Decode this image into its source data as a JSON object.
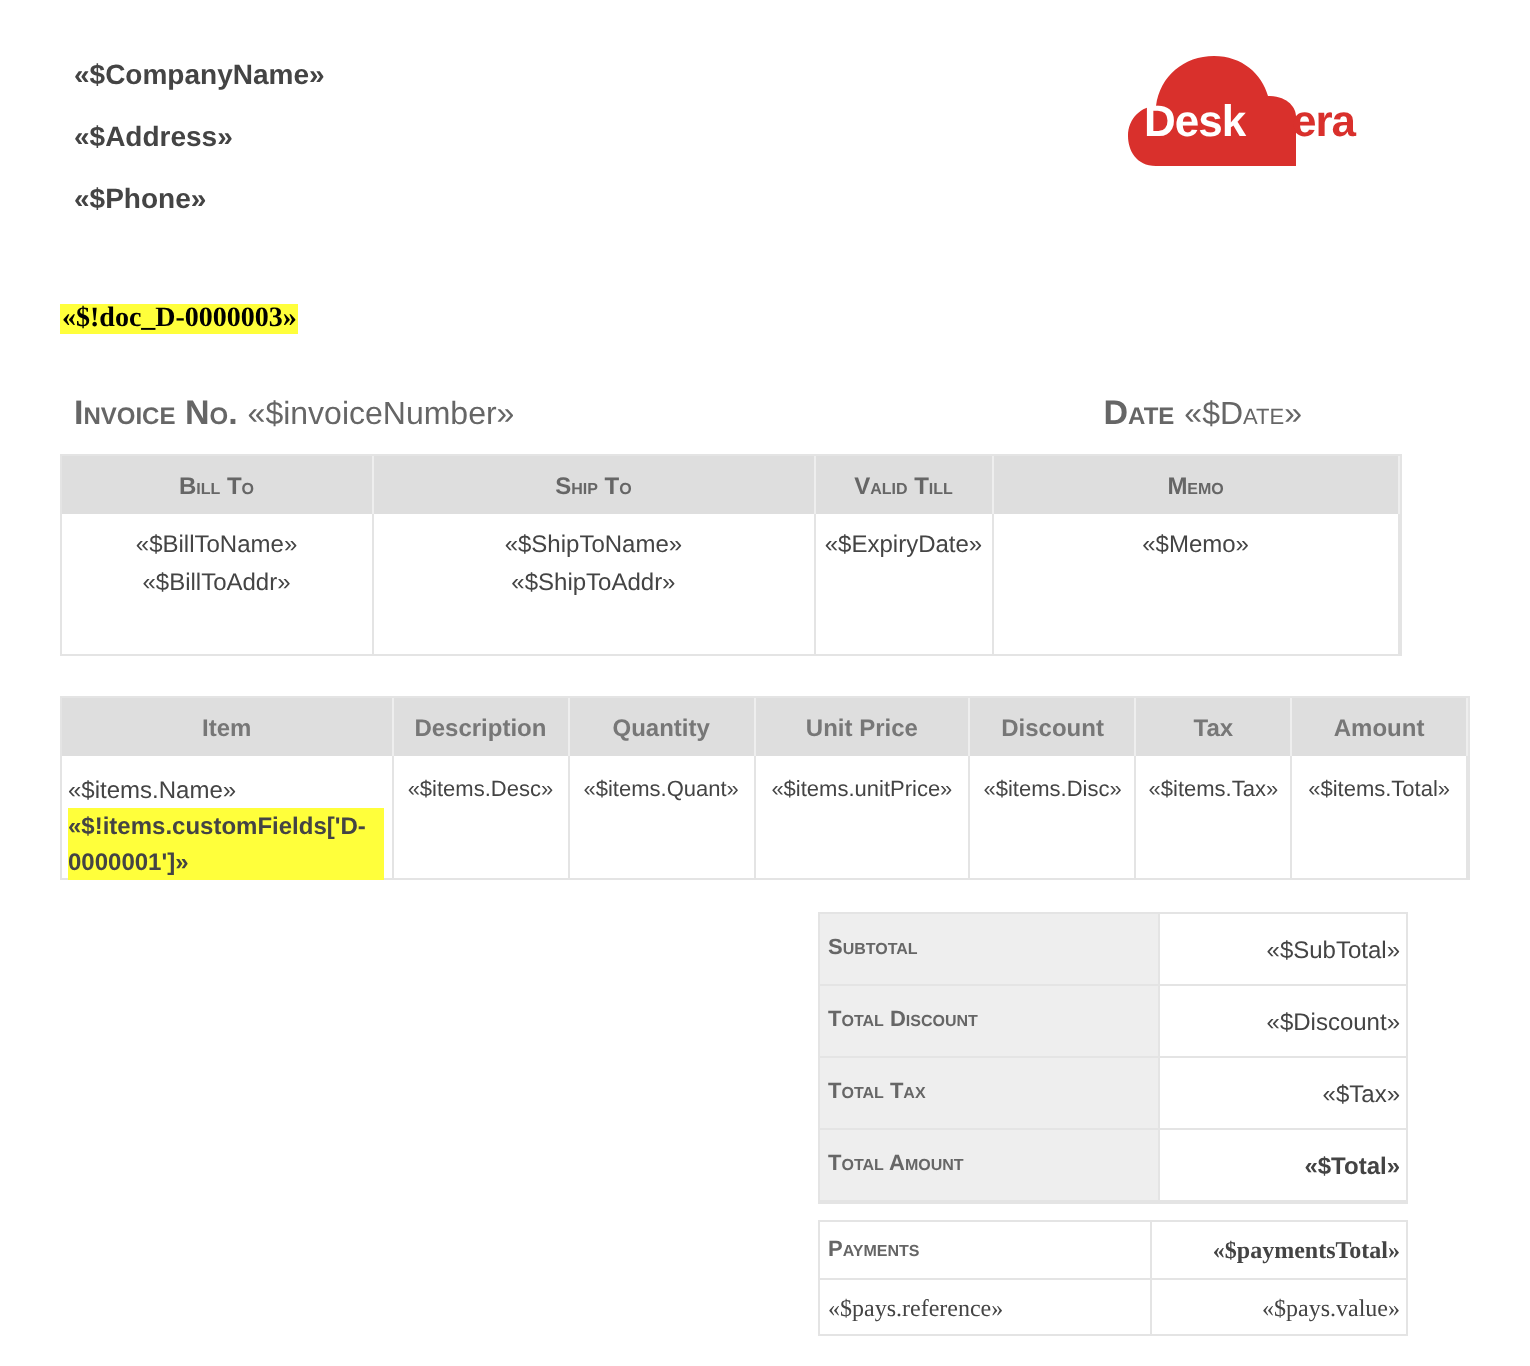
{
  "company": {
    "fields": [
      "«$CompanyName»",
      "«$Address»",
      "«$Phone»"
    ],
    "logo": {
      "text_inside": "Desk",
      "text_outside": "era"
    }
  },
  "doc_tag": "«$!doc_D-0000003»",
  "invoice": {
    "number_label": "Invoice No.",
    "number_value": "«$invoiceNumber»",
    "date_label": "Date",
    "date_value": "«$Date»"
  },
  "info_table": {
    "columns": [
      "Bill To",
      "Ship To",
      "Valid Till",
      "Memo"
    ],
    "cells": [
      [
        "«$BillToName»",
        "«$BillToAddr»"
      ],
      [
        "«$ShipToName»",
        "«$ShipToAddr»"
      ],
      [
        "«$ExpiryDate»"
      ],
      [
        "«$Memo»"
      ]
    ]
  },
  "items_table": {
    "columns": [
      "Item",
      "Description",
      "Quantity",
      "Unit Price",
      "Discount",
      "Tax",
      "Amount"
    ],
    "row": {
      "item_name": "«$items.Name»",
      "custom_field": "«$!items.customFields['D-0000001']»",
      "cells": [
        "«$items.Desc»",
        "«$items.Quant»",
        "«$items.unitPrice»",
        "«$items.Disc»",
        "«$items.Tax»",
        "«$items.Total»"
      ]
    }
  },
  "totals": [
    {
      "label": "Subtotal",
      "value": "«$SubTotal»",
      "bold": false
    },
    {
      "label": "Total Discount",
      "value": "«$Discount»",
      "bold": false
    },
    {
      "label": "Total Tax",
      "value": "«$Tax»",
      "bold": false
    },
    {
      "label": "Total Amount",
      "value": "«$Total»",
      "bold": true
    }
  ],
  "payments": {
    "label": "Payments",
    "total": "«$paymentsTotal»",
    "reference": "«$pays.reference»",
    "value": "«$pays.value»"
  }
}
